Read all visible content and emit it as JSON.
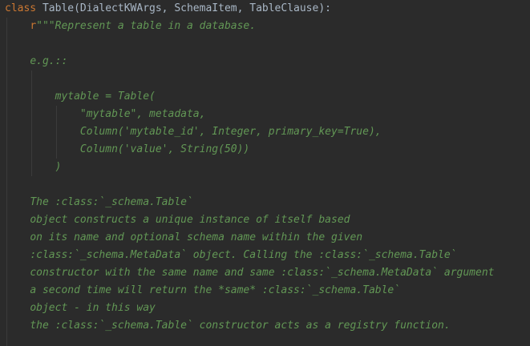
{
  "code": {
    "class_keyword": "class",
    "class_signature": " Table(DialectKWArgs, SchemaItem, TableClause):",
    "docstring_prefix": "r",
    "doc_lines": [
      "\"\"\"Represent a table in a database.",
      "",
      "e.g.::",
      "",
      "",
      "mytable = Table(",
      "    \"mytable\", metadata,",
      "    Column('mytable_id', Integer, primary_key=True),",
      "    Column('value', String(50))",
      ")",
      "",
      "The :class:`_schema.Table`",
      "object constructs a unique instance of itself based",
      "on its name and optional schema name within the given",
      ":class:`_schema.MetaData` object. Calling the :class:`_schema.Table`",
      "constructor with the same name and same :class:`_schema.MetaData` argument",
      "a second time will return the *same* :class:`_schema.Table`",
      "object - in this way",
      "the :class:`_schema.Table` constructor acts as a registry function."
    ]
  },
  "colors": {
    "background": "#2b2b2b",
    "keyword": "#cc7832",
    "identifier": "#a9b7c6",
    "docstring": "#629755",
    "indent_guide": "#3b3b3b"
  }
}
